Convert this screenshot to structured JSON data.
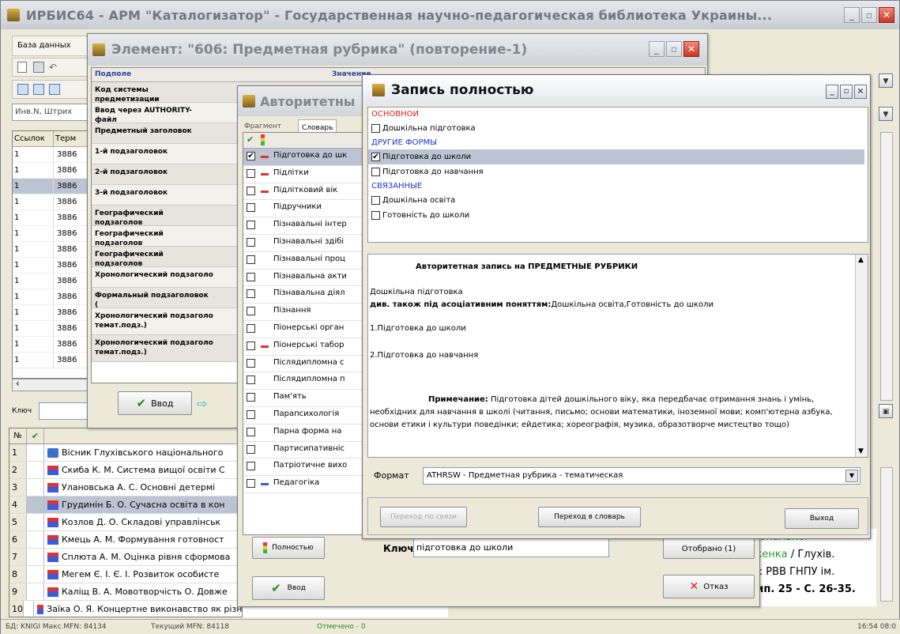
{
  "main_title": "ИРБИС64 - АРМ \"Каталогизатор\" - Государственная научно-педагогическая библиотека Украины...",
  "menu_db": "База данных",
  "ref_left": "Инв.N, Штрих",
  "grid_headers": [
    "Ссылок",
    "Терм"
  ],
  "grid_rows": [
    {
      "a": "1",
      "b": "3886"
    },
    {
      "a": "1",
      "b": "3886"
    },
    {
      "a": "1",
      "b": "3886"
    },
    {
      "a": "1",
      "b": "3886"
    },
    {
      "a": "1",
      "b": "3886"
    },
    {
      "a": "1",
      "b": "3886"
    },
    {
      "a": "1",
      "b": "3886"
    },
    {
      "a": "1",
      "b": "3886"
    },
    {
      "a": "1",
      "b": "3886"
    },
    {
      "a": "1",
      "b": "3886"
    },
    {
      "a": "1",
      "b": "3886"
    },
    {
      "a": "1",
      "b": "3886"
    },
    {
      "a": "1",
      "b": "3886"
    },
    {
      "a": "1",
      "b": "3886"
    }
  ],
  "key_label": "Ключ",
  "book_header": "№",
  "book_rows": [
    {
      "n": "1",
      "t": "Вісник Глухівського національного"
    },
    {
      "n": "2",
      "t": "Скиба К. М. Система вищої освіти С"
    },
    {
      "n": "3",
      "t": "Улановська А. С. Основні детермі"
    },
    {
      "n": "4",
      "t": "Грудинін Б. О. Сучасна освіта в кон"
    },
    {
      "n": "5",
      "t": "Козлов Д. О. Складові управлінськ"
    },
    {
      "n": "6",
      "t": "Кмець А. М. Формування готовност"
    },
    {
      "n": "7",
      "t": "Сплюта А. М. Оцінка рівня сформова"
    },
    {
      "n": "8",
      "t": "Мегем Є. І. Є. І. Розвиток особисте"
    },
    {
      "n": "9",
      "t": "Каліщ В. А. Мовотворчість О. Довже"
    },
    {
      "n": "10",
      "t": "Заїка О. Я. Концертне виконавство як різновид мистецької діяльності в С"
    }
  ],
  "right_text": [
    "ціональног",
    "ткенка / Глухів.",
    "в : РВВ ГНПУ ім.",
    "вип. 25 - С. 26-35."
  ],
  "status": {
    "db": "БД: KNIGI Макс.MFN: 84134",
    "mfn": "Текущий MFN: 84118",
    "sel": "Отмечено - 0",
    "time": "16:54 08:0"
  },
  "elem_title": "Элемент: \"606: Предметная рубрика\" (повторение-1)",
  "elem_headers": [
    "Подполе",
    "Значение"
  ],
  "elem_rows": [
    "Код системы предметизации",
    "Ввод через AUTHORITY-файл",
    "Предметный заголовок",
    "1-й подзаголовок",
    "2-й подзаголовок",
    "3-й подзаголовок",
    "Географический подзаголов",
    "Географический подзаголов",
    "Географический подзаголов",
    "Хронологический подзаголо",
    "Формальный подзаголовок (",
    "Хронологический подзаголо темат.подз.)",
    "Хронологический подзаголо темат.подз.)"
  ],
  "elem_ok": "Ввод",
  "auth_title": "Авторитетны",
  "auth_tabs": [
    "Фрагмент",
    "Словарь"
  ],
  "auth_rows": [
    {
      "t": "Підготовка до шк",
      "c": true,
      "m": "dash"
    },
    {
      "t": "Підлітки",
      "c": false,
      "m": "dash"
    },
    {
      "t": "Підлітковий вік",
      "c": false,
      "m": "dash"
    },
    {
      "t": "Підручники",
      "c": false,
      "m": ""
    },
    {
      "t": "Пізнавальні інтер",
      "c": false,
      "m": ""
    },
    {
      "t": "Пізнавальні здібі",
      "c": false,
      "m": ""
    },
    {
      "t": "Пізнавальні проц",
      "c": false,
      "m": ""
    },
    {
      "t": "Пізнавальна акти",
      "c": false,
      "m": ""
    },
    {
      "t": "Пізнавальна діял",
      "c": false,
      "m": ""
    },
    {
      "t": "Пізнання",
      "c": false,
      "m": ""
    },
    {
      "t": "Піонерські орган",
      "c": false,
      "m": ""
    },
    {
      "t": "Піонерські табор",
      "c": false,
      "m": "dash"
    },
    {
      "t": "Післядипломна с",
      "c": false,
      "m": ""
    },
    {
      "t": "Післядипломна п",
      "c": false,
      "m": ""
    },
    {
      "t": "Пам'ять",
      "c": false,
      "m": ""
    },
    {
      "t": "Парапсихологія",
      "c": false,
      "m": ""
    },
    {
      "t": "Парна форма на",
      "c": false,
      "m": ""
    },
    {
      "t": "Партисипативніс",
      "c": false,
      "m": ""
    },
    {
      "t": "Патріотичне вихо",
      "c": false,
      "m": ""
    },
    {
      "t": "Педагогіка",
      "c": false,
      "m": "tree"
    }
  ],
  "auth_full_btn": "Полностью",
  "auth_ok": "Ввод",
  "key_bottom_label": "Ключ:",
  "key_bottom_value": "підготовка до школи",
  "selected_btn": "Отобрано (1)",
  "cancel_btn": "Отказ",
  "rec_title": "Запись полностью",
  "rec_sections": {
    "main": "ОСНОВНОИ",
    "main_items": [
      "Дошкільна підготовка"
    ],
    "other": "ДРУГИЕ ФОРМЫ",
    "other_items": [
      "Підготовка до школи",
      "Підготовка до навчання"
    ],
    "rel": "СВЯЗАННЫЕ",
    "rel_items": [
      "Дошкільна освіта",
      "Готовність до школи"
    ]
  },
  "rec_body": {
    "heading": "Авторитетная запись на ПРЕДМЕТНЫЕ РУБРИКИ",
    "line1": "Дошкільна підготовка",
    "see_also_label": "див. також під асоціативним поняттям:",
    "see_also_value": "Дошкільна освіта,Готовність до школи",
    "item1": "1.Підготовка до школи",
    "item2": "2.Підготовка до навчання",
    "note_label": "Примечание:",
    "note_text": "Підготовка дітей дошкільного віку, яка передбачає отримання знань і умінь, необхідних для навчання в школі (читання, письмо; основи математики, іноземної мови; комп'ютерна азбука, основи етики і культури поведінки; ейдетика; хореографія, музика, образотворче мистецтво тощо)"
  },
  "format_label": "Формат",
  "format_value": "ATHRSW - Предметная рубрика - тематическая",
  "btn_goto_links": "Переход по связи",
  "btn_goto_dict": "Переход в словарь",
  "btn_exit": "Выход",
  "colors": {
    "title_gray": "#c8ccd2",
    "red": "#e01b1b",
    "blue": "#1a34d8",
    "select": "#bcc4d3"
  }
}
